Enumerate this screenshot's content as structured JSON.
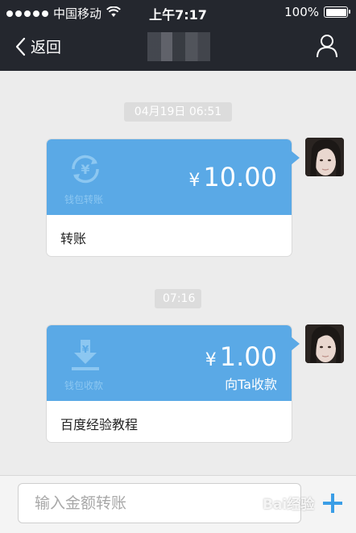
{
  "status": {
    "carrier": "中国移动",
    "time": "上午7:17",
    "battery": "100%"
  },
  "nav": {
    "back": "返回",
    "title": ""
  },
  "messages": [
    {
      "time": "04月19日 06:51",
      "wallet_label": "钱包转账",
      "amount": "10.00",
      "currency": "¥",
      "sub": "",
      "desc": "转账"
    },
    {
      "time": "07:16",
      "wallet_label": "钱包收款",
      "amount": "1.00",
      "currency": "¥",
      "sub": "向Ta收款",
      "desc": "百度经验教程"
    }
  ],
  "input": {
    "placeholder": "输入金额转账"
  },
  "watermark": "Bai经验",
  "colors": {
    "bar": "#24272e",
    "card_blue": "#5aa9e6",
    "background": "#ececec"
  },
  "icons": {
    "back": "chevron-left-icon",
    "profile": "person-icon",
    "plus": "plus-icon",
    "transfer": "wallet-transfer-icon",
    "receive": "wallet-receive-icon"
  }
}
